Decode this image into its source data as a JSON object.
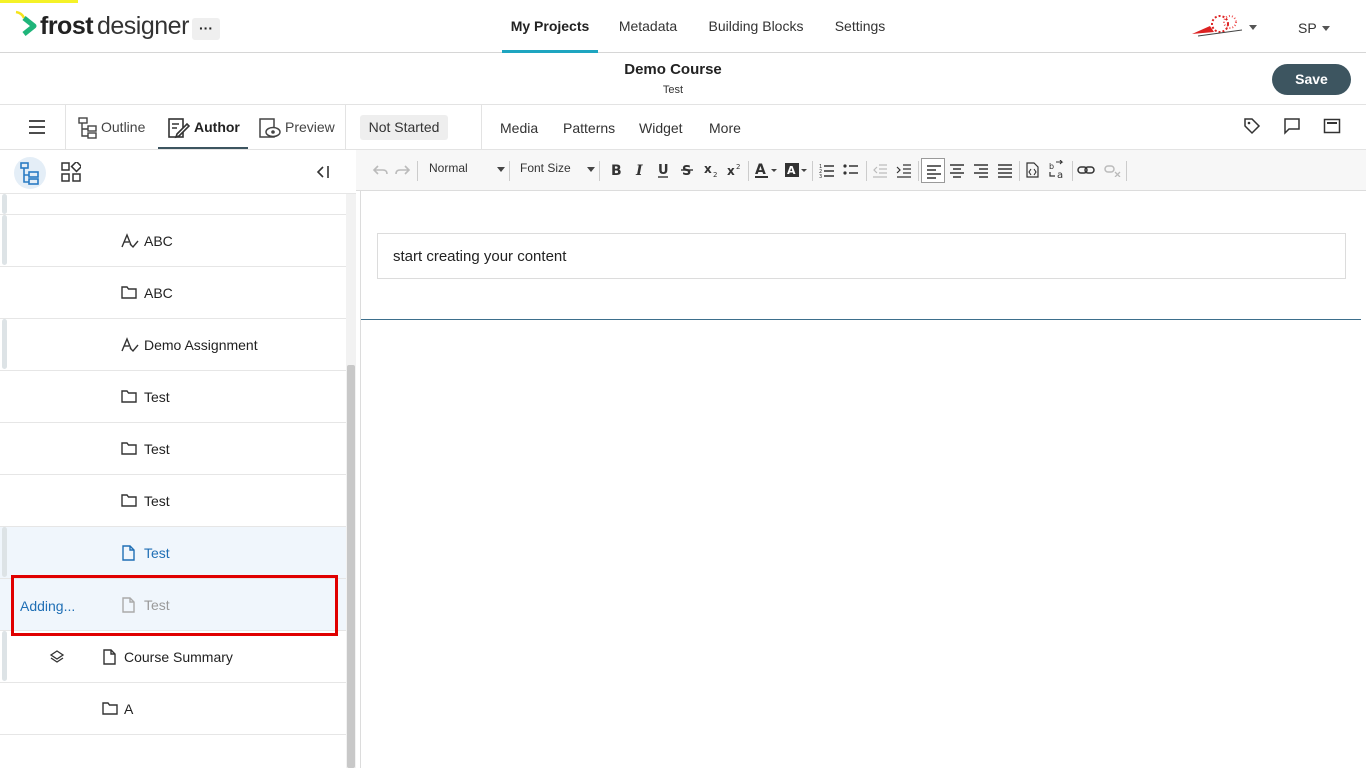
{
  "app": {
    "logo_frost": "frost",
    "logo_designer": "designer",
    "more_label": "···",
    "colors": {
      "accent": "#1ea5c0",
      "primary": "#3d5560",
      "highlight": "#e00000",
      "selected_text": "#1f6fb5"
    }
  },
  "nav": {
    "tabs": [
      {
        "label": "My Projects",
        "active": true
      },
      {
        "label": "Metadata"
      },
      {
        "label": "Building Blocks"
      },
      {
        "label": "Settings"
      }
    ],
    "user_initials": "SP"
  },
  "header": {
    "course_title": "Demo Course",
    "course_subtitle": "Test",
    "save_label": "Save"
  },
  "modebar": {
    "tabs": [
      {
        "label": "Outline",
        "icon": "outline-icon"
      },
      {
        "label": "Author",
        "icon": "author-icon",
        "active": true
      },
      {
        "label": "Preview",
        "icon": "preview-icon"
      }
    ],
    "status": "Not Started",
    "menu": [
      "Media",
      "Patterns",
      "Widget",
      "More"
    ],
    "right_icons": [
      "tag-icon",
      "comment-icon",
      "panel-icon"
    ]
  },
  "tree": {
    "rows": [
      {
        "label": "ABC",
        "icon": "assignment-icon"
      },
      {
        "label": "ABC",
        "icon": "folder-icon"
      },
      {
        "label": "Demo Assignment",
        "icon": "assignment-icon"
      },
      {
        "label": "Test",
        "icon": "folder-icon"
      },
      {
        "label": "Test",
        "icon": "folder-icon"
      },
      {
        "label": "Test",
        "icon": "folder-icon"
      },
      {
        "label": "Test",
        "icon": "page-icon",
        "selected": true
      },
      {
        "label": "Test",
        "icon": "page-icon",
        "adding": true
      },
      {
        "label": "Course Summary",
        "icon": "page-icon"
      },
      {
        "label": "A",
        "icon": "folder-icon"
      }
    ],
    "adding_label": "Adding..."
  },
  "editor": {
    "format_select": "Normal",
    "font_size_select": "Font Size",
    "content_text": "start creating your content"
  }
}
